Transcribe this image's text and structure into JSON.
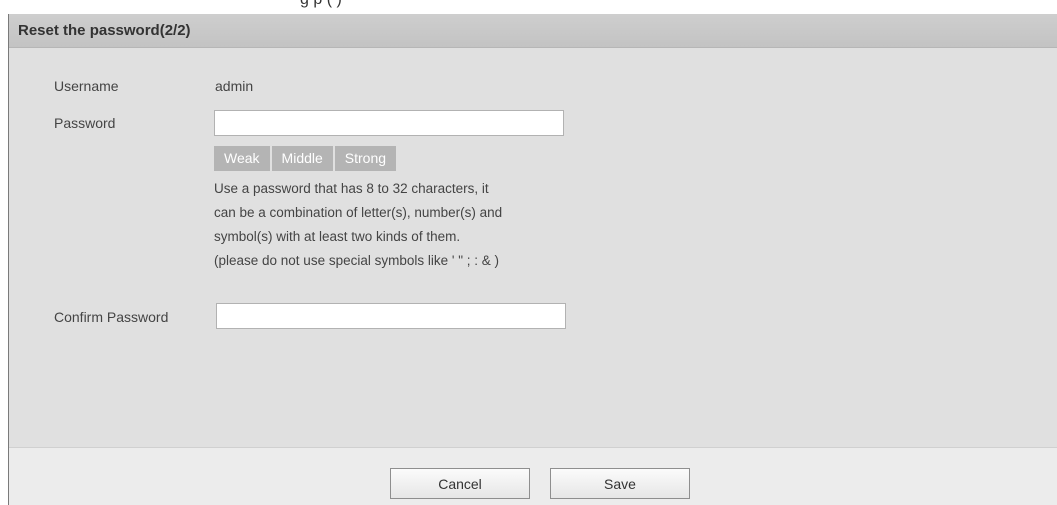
{
  "top_caption": "g                                  p           (   )",
  "dialog": {
    "title": "Reset the password(2/2)",
    "username_label": "Username",
    "username_value": "admin",
    "password_label": "Password",
    "password_value": "",
    "strength_levels": [
      "Weak",
      "Middle",
      "Strong"
    ],
    "hint_lines": [
      "Use a password that has 8 to 32 characters, it",
      "can be a combination of letter(s), number(s) and",
      "symbol(s) with at least two kinds of them.",
      "(please do not use special symbols like ' \" ; : & )"
    ],
    "confirm_label": "Confirm Password",
    "confirm_value": ""
  },
  "footer": {
    "cancel_label": "Cancel",
    "save_label": "Save"
  }
}
